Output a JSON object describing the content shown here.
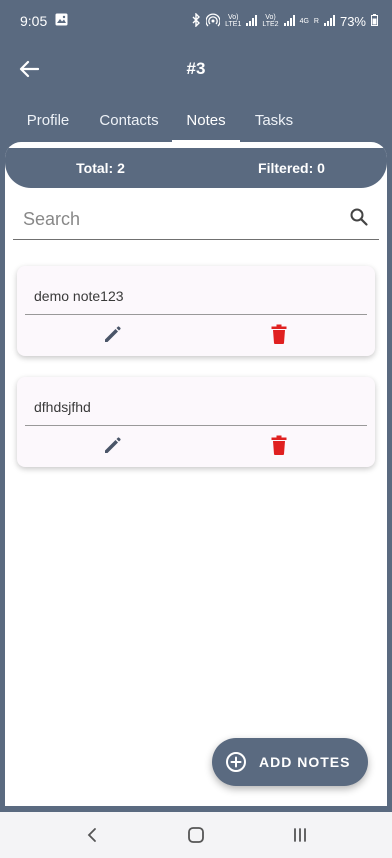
{
  "status_bar": {
    "time": "9:05",
    "lte1": "Vo)\nLTE1",
    "lte2": "Vo)\nLTE2",
    "net": "4G",
    "r": "R",
    "battery": "73%"
  },
  "appbar": {
    "title": "#3"
  },
  "tabs": [
    {
      "label": "Profile"
    },
    {
      "label": "Contacts"
    },
    {
      "label": "Notes"
    },
    {
      "label": "Tasks"
    }
  ],
  "summary": {
    "total": "Total: 2",
    "filtered": "Filtered: 0"
  },
  "search": {
    "placeholder": "Search",
    "value": ""
  },
  "notes": [
    {
      "text": "demo note123"
    },
    {
      "text": "dfhdsjfhd"
    }
  ],
  "fab": {
    "label": "ADD NOTES"
  },
  "colors": {
    "primary": "#5a6a80",
    "delete": "#e02020",
    "edit": "#4a5568"
  }
}
